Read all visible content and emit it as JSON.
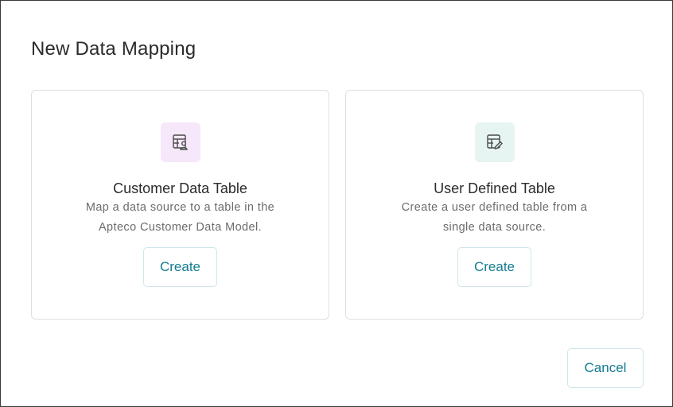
{
  "dialog": {
    "title": "New Data Mapping",
    "cancel_label": "Cancel"
  },
  "options": [
    {
      "title": "Customer Data Table",
      "description_line1": "Map a data source to a table in the",
      "description_line2": "Apteco Customer Data Model.",
      "button_label": "Create",
      "icon": "table-user-icon",
      "icon_bg": "#f6e7fb"
    },
    {
      "title": "User Defined Table",
      "description_line1": "Create a user defined table from a",
      "description_line2": "single data source.",
      "button_label": "Create",
      "icon": "table-edit-icon",
      "icon_bg": "#e6f5f1"
    }
  ],
  "colors": {
    "accent": "#137c91",
    "title_text": "#2b2b2b",
    "muted_text": "#6b6b6b"
  }
}
